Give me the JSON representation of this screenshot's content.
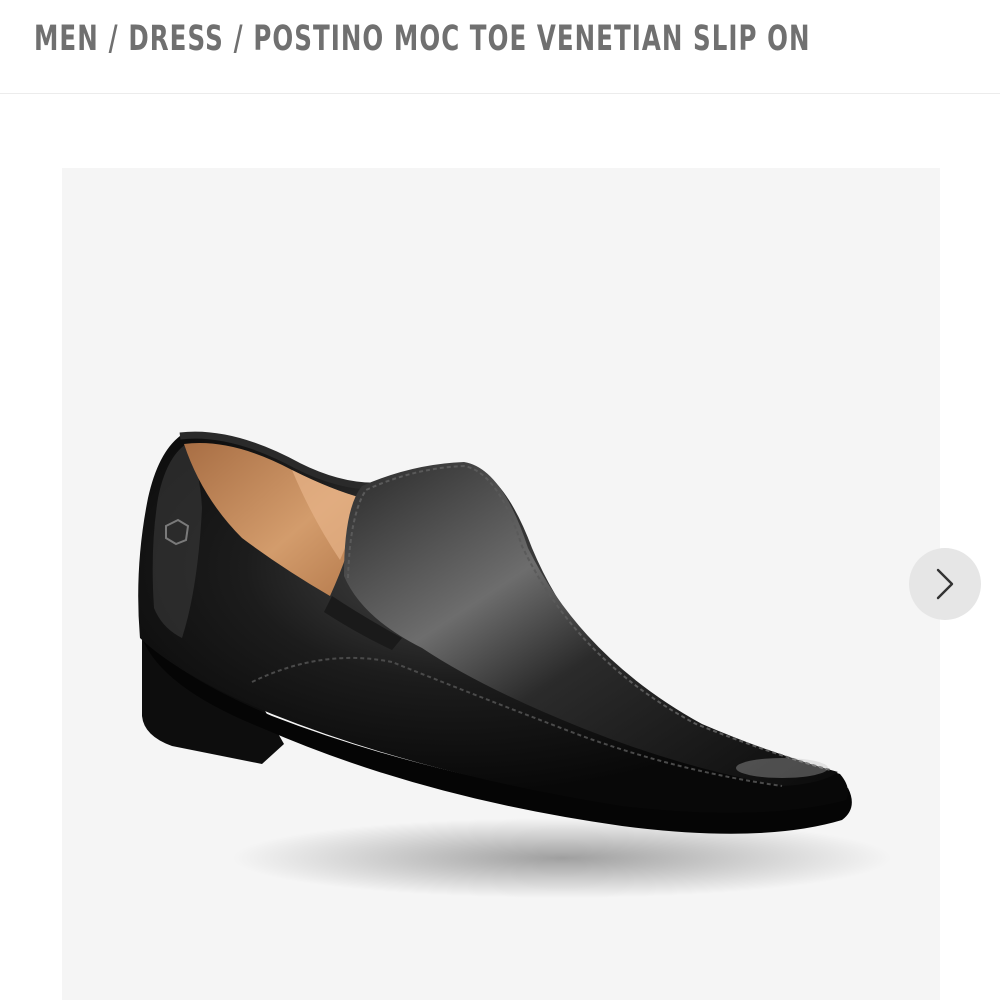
{
  "breadcrumb": {
    "items": [
      {
        "label": "MEN"
      },
      {
        "label": "DRESS"
      },
      {
        "label": "POSTINO MOC TOE VENETIAN SLIP ON"
      }
    ],
    "separator": "/"
  },
  "gallery": {
    "image_icon": "black-leather-slip-on-shoe",
    "next_icon": "chevron-right-icon"
  },
  "colors": {
    "breadcrumb_text": "#707070",
    "gallery_bg": "#f5f5f5",
    "nav_button_bg": "#e6e6e6",
    "shoe_leather": "#111111",
    "lining": "#c48a5a"
  }
}
